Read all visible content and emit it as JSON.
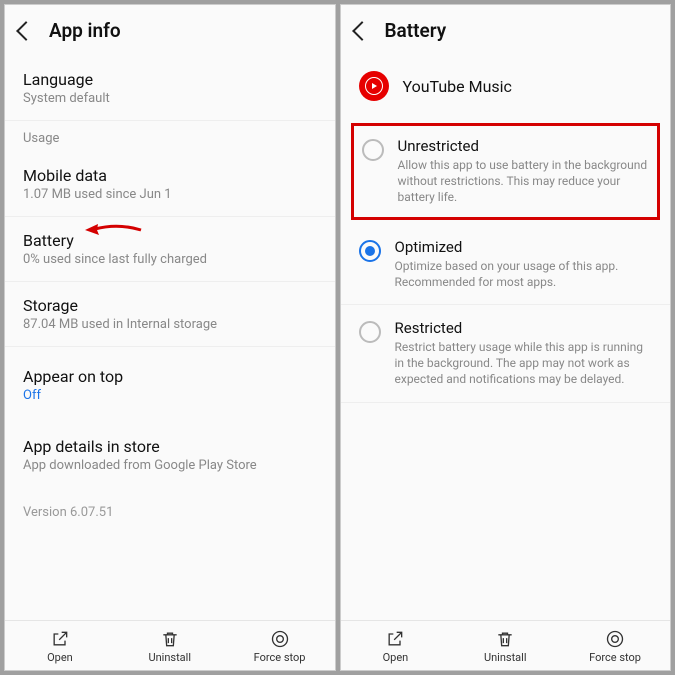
{
  "left": {
    "header": {
      "title": "App info"
    },
    "language": {
      "title": "Language",
      "sub": "System default"
    },
    "usage_label": "Usage",
    "mobile_data": {
      "title": "Mobile data",
      "sub": "1.07 MB used since Jun 1"
    },
    "battery": {
      "title": "Battery",
      "sub": "0% used since last fully charged"
    },
    "storage": {
      "title": "Storage",
      "sub": "87.04 MB used in Internal storage"
    },
    "appear": {
      "title": "Appear on top",
      "sub": "Off"
    },
    "details": {
      "title": "App details in store",
      "sub": "App downloaded from Google Play Store"
    },
    "version": "Version 6.07.51",
    "bottom": {
      "open": "Open",
      "uninstall": "Uninstall",
      "force": "Force stop"
    }
  },
  "right": {
    "header": {
      "title": "Battery"
    },
    "app_name": "YouTube Music",
    "options": {
      "unrestricted": {
        "title": "Unrestricted",
        "desc": "Allow this app to use battery in the background without restrictions. This may reduce your battery life."
      },
      "optimized": {
        "title": "Optimized",
        "desc": "Optimize based on your usage of this app. Recommended for most apps."
      },
      "restricted": {
        "title": "Restricted",
        "desc": "Restrict battery usage while this app is running in the background. The app may not work as expected and notifications may be delayed."
      }
    },
    "bottom": {
      "open": "Open",
      "uninstall": "Uninstall",
      "force": "Force stop"
    }
  }
}
